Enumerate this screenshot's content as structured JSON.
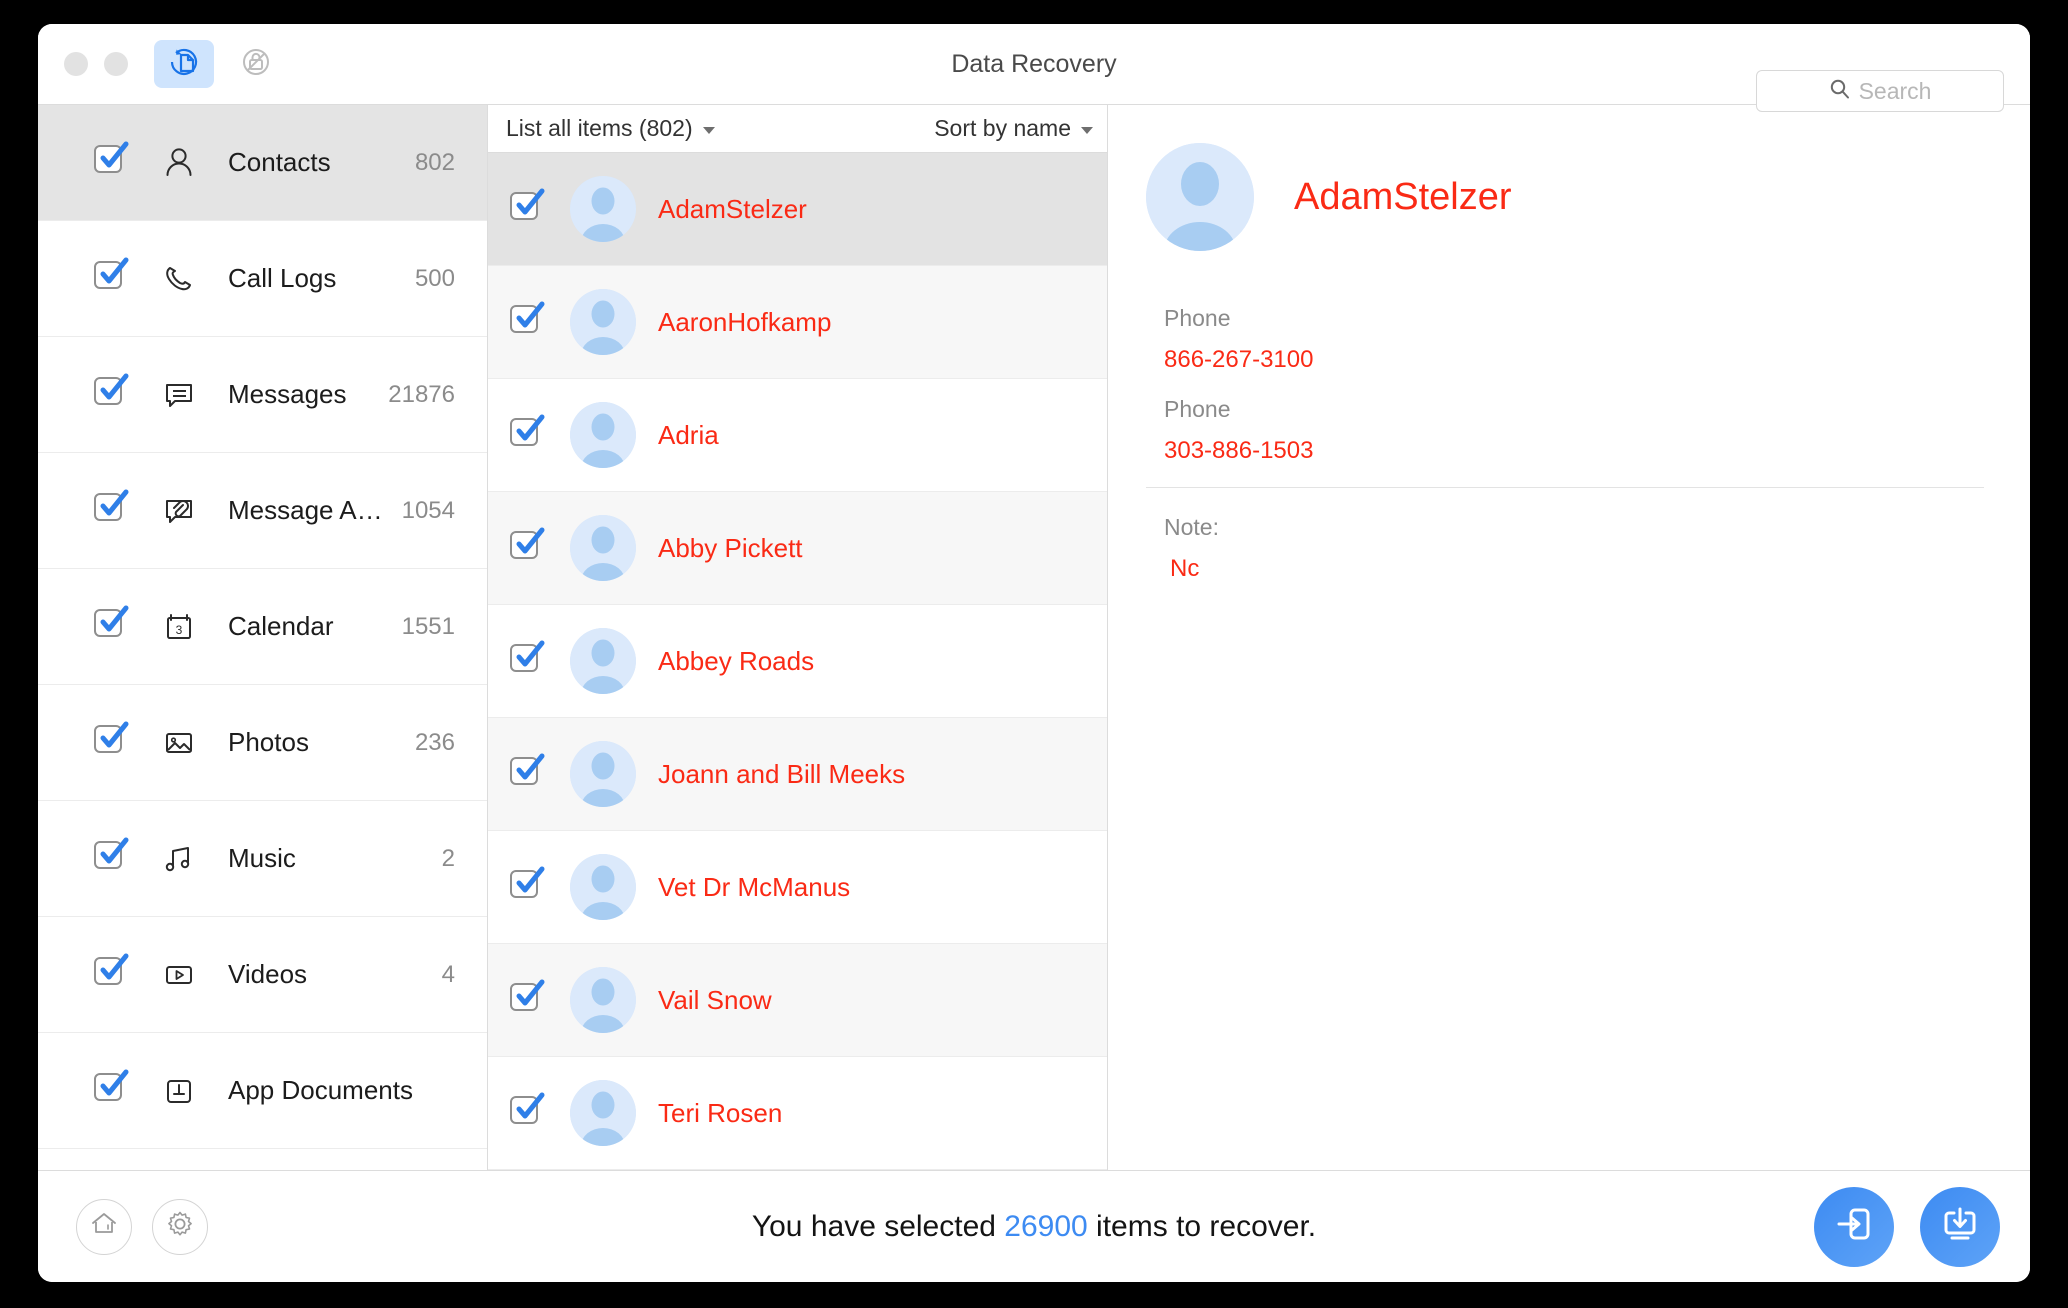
{
  "window": {
    "title": "Data Recovery",
    "traffic_lights": [
      "close",
      "minimize"
    ],
    "tabs": [
      {
        "name": "recover-from-device",
        "icon": "document-restore-icon",
        "active": true
      },
      {
        "name": "recover-from-backup",
        "icon": "locked-backup-icon",
        "active": false
      }
    ]
  },
  "search": {
    "placeholder": "Search",
    "value": "",
    "icon": "search-icon"
  },
  "sidebar": {
    "items": [
      {
        "label": "Contacts",
        "count": "802",
        "icon": "person-icon",
        "checked": true,
        "selected": true
      },
      {
        "label": "Call Logs",
        "count": "500",
        "icon": "phone-icon",
        "checked": true,
        "selected": false
      },
      {
        "label": "Messages",
        "count": "21876",
        "icon": "message-icon",
        "checked": true,
        "selected": false
      },
      {
        "label": "Message Attac…",
        "count": "1054",
        "icon": "attachment-icon",
        "checked": true,
        "selected": false
      },
      {
        "label": "Calendar",
        "count": "1551",
        "icon": "calendar-icon",
        "checked": true,
        "selected": false
      },
      {
        "label": "Photos",
        "count": "236",
        "icon": "photo-icon",
        "checked": true,
        "selected": false
      },
      {
        "label": "Music",
        "count": "2",
        "icon": "music-icon",
        "checked": true,
        "selected": false
      },
      {
        "label": "Videos",
        "count": "4",
        "icon": "video-icon",
        "checked": true,
        "selected": false
      },
      {
        "label": "App Documents",
        "count": "",
        "icon": "app-document-icon",
        "checked": true,
        "selected": false
      }
    ]
  },
  "list": {
    "filter_label": "List all items (802)",
    "sort_label": "Sort by name",
    "contacts": [
      {
        "name": "AdamStelzer",
        "checked": true,
        "selected": true
      },
      {
        "name": "AaronHofkamp",
        "checked": true,
        "selected": false
      },
      {
        "name": "Adria",
        "checked": true,
        "selected": false
      },
      {
        "name": "Abby Pickett",
        "checked": true,
        "selected": false
      },
      {
        "name": "Abbey Roads",
        "checked": true,
        "selected": false
      },
      {
        "name": "Joann and Bill Meeks",
        "checked": true,
        "selected": false
      },
      {
        "name": "Vet Dr McManus",
        "checked": true,
        "selected": false
      },
      {
        "name": "Vail Snow",
        "checked": true,
        "selected": false
      },
      {
        "name": "Teri Rosen",
        "checked": true,
        "selected": false
      }
    ]
  },
  "detail": {
    "name": "AdamStelzer",
    "avatar_icon": "person-avatar-icon",
    "fields": [
      {
        "label": "Phone",
        "value": "866-267-3100"
      },
      {
        "label": "Phone",
        "value": "303-886-1503"
      }
    ],
    "note_label": "Note:",
    "note_value": "Nc"
  },
  "footer": {
    "home_icon": "home-icon",
    "settings_icon": "gear-icon",
    "status_prefix": "You have selected ",
    "status_count": "26900",
    "status_suffix": " items to recover.",
    "actions": [
      {
        "name": "recover-to-device-button",
        "icon": "arrow-into-phone-icon"
      },
      {
        "name": "recover-to-computer-button",
        "icon": "download-to-computer-icon"
      }
    ]
  },
  "colors": {
    "accent_blue": "#3d8bf2",
    "item_red": "#fa2a15",
    "selected_gray": "#e4e4e4",
    "alt_row": "#f7f7f7"
  }
}
